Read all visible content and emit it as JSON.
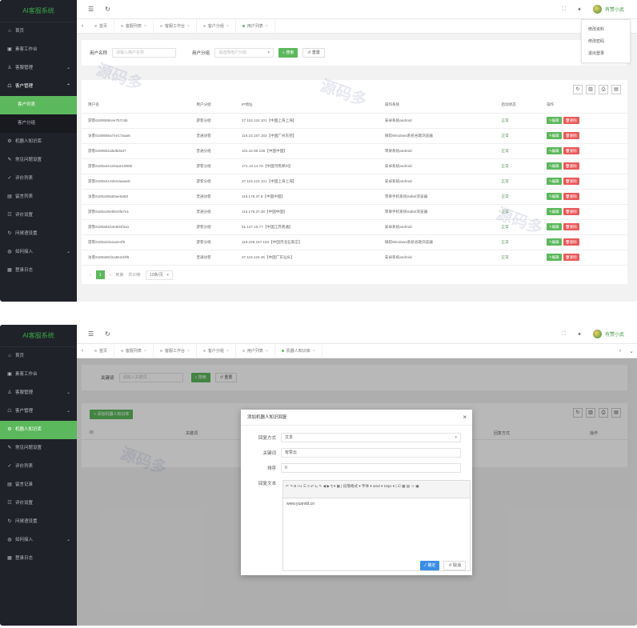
{
  "app": {
    "title": "AI客服系统",
    "user": "有赞小武"
  },
  "sidebar1": {
    "items": [
      {
        "icon": "⌂",
        "label": "首页",
        "chev": ""
      },
      {
        "icon": "▣",
        "label": "素客工作台",
        "chev": ""
      },
      {
        "icon": "♙",
        "label": "客服管理",
        "chev": "⌄"
      },
      {
        "icon": "☖",
        "label": "客户管理",
        "chev": "⌃",
        "open": true
      }
    ],
    "sub": [
      {
        "label": "客户列表",
        "active": true
      },
      {
        "label": "客户分组"
      }
    ],
    "rest": [
      {
        "icon": "⚙",
        "label": "机器人知识库"
      },
      {
        "icon": "✎",
        "label": "常见问题设置"
      },
      {
        "icon": "✓",
        "label": "评价列表"
      },
      {
        "icon": "▤",
        "label": "留言列表"
      },
      {
        "icon": "☷",
        "label": "评价设置"
      },
      {
        "icon": "↻",
        "label": "问候语设置"
      },
      {
        "icon": "◍",
        "label": "如何接入",
        "chev": "⌄"
      },
      {
        "icon": "▦",
        "label": "登录日志"
      }
    ]
  },
  "sidebar2": {
    "items": [
      {
        "icon": "⌂",
        "label": "首页",
        "chev": ""
      },
      {
        "icon": "▣",
        "label": "素客工作台",
        "chev": ""
      },
      {
        "icon": "♙",
        "label": "客服管理",
        "chev": "⌄"
      },
      {
        "icon": "☖",
        "label": "客户管理",
        "chev": "⌄"
      },
      {
        "icon": "⚙",
        "label": "机器人知识库",
        "active": true
      },
      {
        "icon": "✎",
        "label": "常见问题设置"
      },
      {
        "icon": "✓",
        "label": "评价列表"
      },
      {
        "icon": "▤",
        "label": "留言记录"
      },
      {
        "icon": "☷",
        "label": "评价设置"
      },
      {
        "icon": "↻",
        "label": "问候语设置"
      },
      {
        "icon": "◍",
        "label": "如何接入",
        "chev": "⌄"
      },
      {
        "icon": "▦",
        "label": "登录日志"
      }
    ]
  },
  "tabs1": [
    "首页",
    "客服列表",
    "客服工作台",
    "客户分组",
    "用户列表"
  ],
  "tabs2": [
    "首页",
    "客服列表",
    "客服工作台",
    "客户分组",
    "用户列表",
    "机器人知识库"
  ],
  "dropdown": [
    "修改资料",
    "修改密码",
    "退出登录"
  ],
  "filter1": {
    "label1": "用户名称",
    "ph1": "请输入用户名称",
    "label2": "用户分组",
    "ph2": "请选择用户分组",
    "search": "搜索",
    "reset": "重置"
  },
  "table": {
    "headers": [
      "用户名",
      "用户分组",
      "IP地址",
      "操作系统",
      "启动状态",
      "操作"
    ],
    "rows": [
      [
        "游客6180659cee7b7c5b",
        "游客分组",
        "27.115.124.101【中国上海上海】",
        "安卓系统android",
        "正常"
      ],
      [
        "访客6180656a74e17aaa6",
        "普通访客",
        "116.23.157.163【中国广州东莞】",
        "微软Windows系统谷歌浏览器",
        "正常"
      ],
      [
        "游客6180651abd9d4d7",
        "普通分组",
        "101.42.95.166【中国中国】",
        "苹果系统android",
        "正常"
      ],
      [
        "游客6180a4e1e5aae1868b",
        "游客分组",
        "171.13.14.76【中国河南郑州】",
        "安卓系统android",
        "正常"
      ],
      [
        "游客6180a414d4e3aaae8",
        "游客分组",
        "27.115.124.101【中国上海上海】",
        "安卓系统android",
        "正常"
      ],
      [
        "访客6180a36a83ae5a83",
        "普通访客",
        "116.179.37.8【中国中国】",
        "苹果手机系统Safari浏览器",
        "正常"
      ],
      [
        "游客6180a26eb8c0fa7e1",
        "普通分组",
        "116.179.37.38【中国中国】",
        "苹果手机系统Safari浏览器",
        "正常"
      ],
      [
        "游客6180a91b4e9d4f3a1",
        "游客分组",
        "61.147.15.77【中国江苏南通】",
        "安卓系统android",
        "正常"
      ],
      [
        "游客6180a23a1a2e4f5",
        "游客分组",
        "116.226.157.163【中国河北石家庄】",
        "微软Windows系统谷歌浏览器",
        "正常"
      ],
      [
        "访客6180a60d1a8e2d3f6",
        "普通访客",
        "27.115.124.45【中国广东汕头】",
        "安卓系统android",
        "正常"
      ]
    ],
    "edit": "编辑",
    "del": "删除"
  },
  "pager": {
    "page": "1",
    "goto": "到第",
    "total": "共10条",
    "size": "10条/页"
  },
  "filter2": {
    "label": "关键词",
    "ph": "请输入关键词",
    "search": "搜索",
    "reset": "重置"
  },
  "kb": {
    "add": "添加机器人知识库",
    "headers": [
      "ID",
      "关键词",
      "回复方式",
      "操作"
    ]
  },
  "modal": {
    "title": "添加机器人知识回复",
    "l1": "回复方式",
    "v1": "文本",
    "l2": "关键词",
    "v2": "有赞云",
    "l3": "排序",
    "v3": "0",
    "l4": "回复文本",
    "toolbar": "↶ ↷ B I U ☰ ≡ x² x₂ ✎ ◀ ▶ ¶ ▾ ▦ | 段落格式 ▾ 字体 ▾ arial ▾ 16px ▾ | ☑ ▦ ▤ ☺ ▣",
    "content": "www.yuandd.cn",
    "ok": "确定",
    "cancel": "取消"
  },
  "watermark": "源码多"
}
